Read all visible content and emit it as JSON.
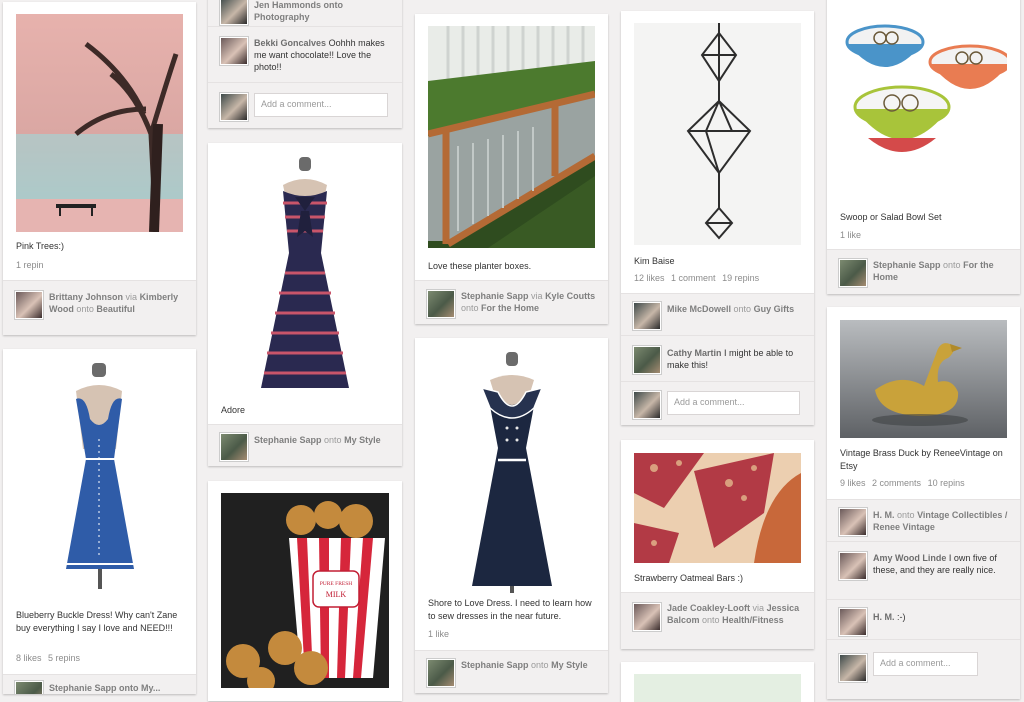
{
  "col1": {
    "pin1": {
      "desc": "Pink Trees:)",
      "repins": "1 repin",
      "pinner": "Brittany Johnson",
      "via_word": "via",
      "via_user": "Kimberly Wood",
      "onto_word": "onto",
      "board": "Beautiful"
    },
    "pin2": {
      "desc": "Blueberry Buckle Dress! Why can't Zane buy everything I say I love and NEED!!!",
      "likes": "8 likes",
      "repins": "5 repins",
      "pinner_partial": "Stephanie Sapp onto My..."
    }
  },
  "col2": {
    "pin_top": {
      "pinner_partial": "Jen Hammonds onto",
      "board": "Photography",
      "comment_user": "Bekki Goncalves",
      "comment_text": "Oohhh makes me want chocolate!! Love the photo!!",
      "comment_placeholder": "Add a comment..."
    },
    "pin2": {
      "desc": "Adore",
      "pinner": "Stephanie Sapp",
      "onto_word": "onto",
      "board": "My Style"
    },
    "pin3": {
      "popcorn_label_top": "PURE FRESH",
      "popcorn_label_bottom": "MILK"
    }
  },
  "col3": {
    "pin1": {
      "desc": "Love these planter boxes.",
      "pinner": "Stephanie Sapp",
      "via_word": "via",
      "via_user": "Kyle Coutts",
      "onto_word": "onto",
      "board": "For the Home"
    },
    "pin2": {
      "desc": "Shore to Love Dress. I need to learn how to sew dresses in the near future.",
      "likes": "1 like",
      "pinner": "Stephanie Sapp",
      "onto_word": "onto",
      "board": "My Style"
    }
  },
  "col4": {
    "pin1": {
      "desc": "Kim Baise",
      "likes": "12 likes",
      "comments": "1 comment",
      "repins": "19 repins",
      "pinner": "Mike McDowell",
      "onto_word": "onto",
      "board": "Guy Gifts",
      "comment_user": "Cathy Martin",
      "comment_text": "I might be able to make this!",
      "comment_placeholder": "Add a comment..."
    },
    "pin2": {
      "desc": "Strawberry Oatmeal Bars :)",
      "pinner": "Jade Coakley-Looft",
      "via_word": "via",
      "via_user": "Jessica Balcom",
      "onto_word": "onto",
      "board": "Health/Fitness"
    }
  },
  "col5": {
    "pin1": {
      "desc": "Swoop or Salad Bowl Set",
      "likes": "1 like",
      "pinner": "Stephanie Sapp",
      "onto_word": "onto",
      "board": "For the Home"
    },
    "pin2": {
      "desc": "Vintage Brass Duck by ReneeVintage on Etsy",
      "likes": "9 likes",
      "comments": "2 comments",
      "repins": "10 repins",
      "pinner": "H. M.",
      "onto_word": "onto",
      "board": "Vintage Collectibles / Renee Vintage",
      "comment1_user": "Amy Wood Linde",
      "comment1_text": "I own five of these, and they are really nice.",
      "comment2_user": "H. M.",
      "comment2_text": ":-)",
      "comment_placeholder": "Add a comment..."
    }
  }
}
